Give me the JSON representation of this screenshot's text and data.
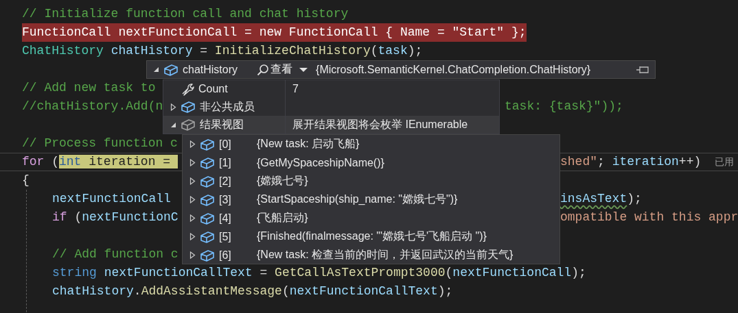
{
  "code_lines": [
    {
      "kind": "normal",
      "segments": [
        {
          "kind": "comment",
          "text": "// Initialize function call and chat history"
        }
      ]
    },
    {
      "kind": "breakpoint",
      "segments": [
        {
          "kind": "plain",
          "text": "FunctionCall nextFunctionCall = new FunctionCall { Name = \"Start\" };"
        }
      ]
    },
    {
      "kind": "normal",
      "segments": [
        {
          "kind": "type",
          "text": "ChatHistory "
        },
        {
          "kind": "variable",
          "text": "chatHistory"
        },
        {
          "kind": "plain",
          "text": " = "
        },
        {
          "kind": "method",
          "text": "InitializeChatHistory"
        },
        {
          "kind": "plain",
          "text": "("
        },
        {
          "kind": "variable",
          "text": "task"
        },
        {
          "kind": "plain",
          "text": ");"
        }
      ]
    },
    {
      "kind": "blank"
    },
    {
      "kind": "normal",
      "segments": [
        {
          "kind": "comment",
          "text": "// Add new task to"
        }
      ]
    },
    {
      "kind": "normal",
      "segments": [
        {
          "kind": "comment",
          "text": "//chatHistory.Add(n"
        }
      ],
      "after": {
        "kind": "beside_members",
        "segments": [
          {
            "kind": "comment",
            "text": "task: {task}\"));"
          }
        ]
      }
    },
    {
      "kind": "blank"
    },
    {
      "kind": "normal",
      "segments": [
        {
          "kind": "comment",
          "text": "// Process function c"
        }
      ]
    },
    {
      "kind": "current",
      "segments": [
        {
          "kind": "control",
          "text": "for"
        },
        {
          "kind": "plain",
          "text": " ("
        },
        {
          "kind": "keyword",
          "text": "int",
          "highlighted": true
        },
        {
          "kind": "plain",
          "text": " iteration = ",
          "highlighted": true
        }
      ],
      "after": {
        "kind": "beside_items",
        "segments": [
          {
            "kind": "string",
            "text": "shed\""
          },
          {
            "kind": "plain",
            "text": "; "
          },
          {
            "kind": "variable",
            "text": "iteration"
          },
          {
            "kind": "plain",
            "text": "++)"
          }
        ],
        "hint": "已用"
      }
    },
    {
      "kind": "normal",
      "segments": [
        {
          "kind": "plain",
          "text": "{"
        }
      ]
    },
    {
      "kind": "block",
      "children": [
        {
          "kind": "normal",
          "segments": [
            {
              "kind": "variable",
              "text": "nextFunctionCall"
            }
          ],
          "after": {
            "kind": "beside_items",
            "segments": [
              {
                "kind": "variable",
                "text": "insAsText",
                "squiggle": true
              },
              {
                "kind": "plain",
                "text": ");"
              }
            ]
          }
        },
        {
          "kind": "normal",
          "segments": [
            {
              "kind": "control",
              "text": "if"
            },
            {
              "kind": "plain",
              "text": " ("
            },
            {
              "kind": "variable",
              "text": "nextFunctionC"
            }
          ],
          "after": {
            "kind": "beside_items",
            "segments": [
              {
                "kind": "string",
                "text": "ompatible with this appr"
              }
            ]
          }
        },
        {
          "kind": "blank"
        },
        {
          "kind": "normal",
          "segments": [
            {
              "kind": "comment",
              "text": "// Add function c"
            }
          ]
        },
        {
          "kind": "normal",
          "segments": [
            {
              "kind": "keyword",
              "text": "string "
            },
            {
              "kind": "variable",
              "text": "nextFunctionCallText"
            },
            {
              "kind": "plain",
              "text": " = "
            },
            {
              "kind": "method",
              "text": "GetCallAsTextPrompt3000"
            },
            {
              "kind": "plain",
              "text": "("
            },
            {
              "kind": "variable",
              "text": "nextFunctionCall"
            },
            {
              "kind": "plain",
              "text": ");"
            }
          ]
        },
        {
          "kind": "normal",
          "segments": [
            {
              "kind": "variable",
              "text": "chatHistory"
            },
            {
              "kind": "plain",
              "text": "."
            },
            {
              "kind": "method",
              "text": "AddAssistantMessage"
            },
            {
              "kind": "plain",
              "text": "("
            },
            {
              "kind": "variable",
              "text": "nextFunctionCallText"
            },
            {
              "kind": "plain",
              "text": ");"
            }
          ]
        },
        {
          "kind": "blank"
        }
      ]
    }
  ],
  "datatip": {
    "expression": "chatHistory",
    "expanded": true,
    "search_label": "查看",
    "value": "{Microsoft.SemanticKernel.ChatCompletion.ChatHistory}",
    "members": [
      {
        "kind": "property",
        "name": "Count",
        "value": "7",
        "selected": false
      },
      {
        "kind": "group",
        "name": "非公共成员",
        "expanded": false,
        "selected": false
      },
      {
        "kind": "results",
        "name": "结果视图",
        "expanded": true,
        "value": "展开结果视图将会枚举 IEnumerable",
        "selected": true
      }
    ],
    "items": [
      {
        "name": "[0]",
        "value": "{New task: 启动飞船}",
        "expanded": false
      },
      {
        "name": "[1]",
        "value": "{GetMySpaceshipName()}",
        "expanded": false
      },
      {
        "name": "[2]",
        "value": "{嫦娥七号}",
        "expanded": false
      },
      {
        "name": "[3]",
        "value": "{StartSpaceship(ship_name: \"嫦娥七号\")}",
        "expanded": false
      },
      {
        "name": "[4]",
        "value": "{飞船启动}",
        "expanded": false
      },
      {
        "name": "[5]",
        "value": "{Finished(finalmessage: \"'嫦娥七号'飞船启动 \")}",
        "expanded": false
      },
      {
        "name": "[6]",
        "value": "{New task: 检查当前的时间，并返回武汉的当前天气}",
        "expanded": false
      }
    ]
  }
}
